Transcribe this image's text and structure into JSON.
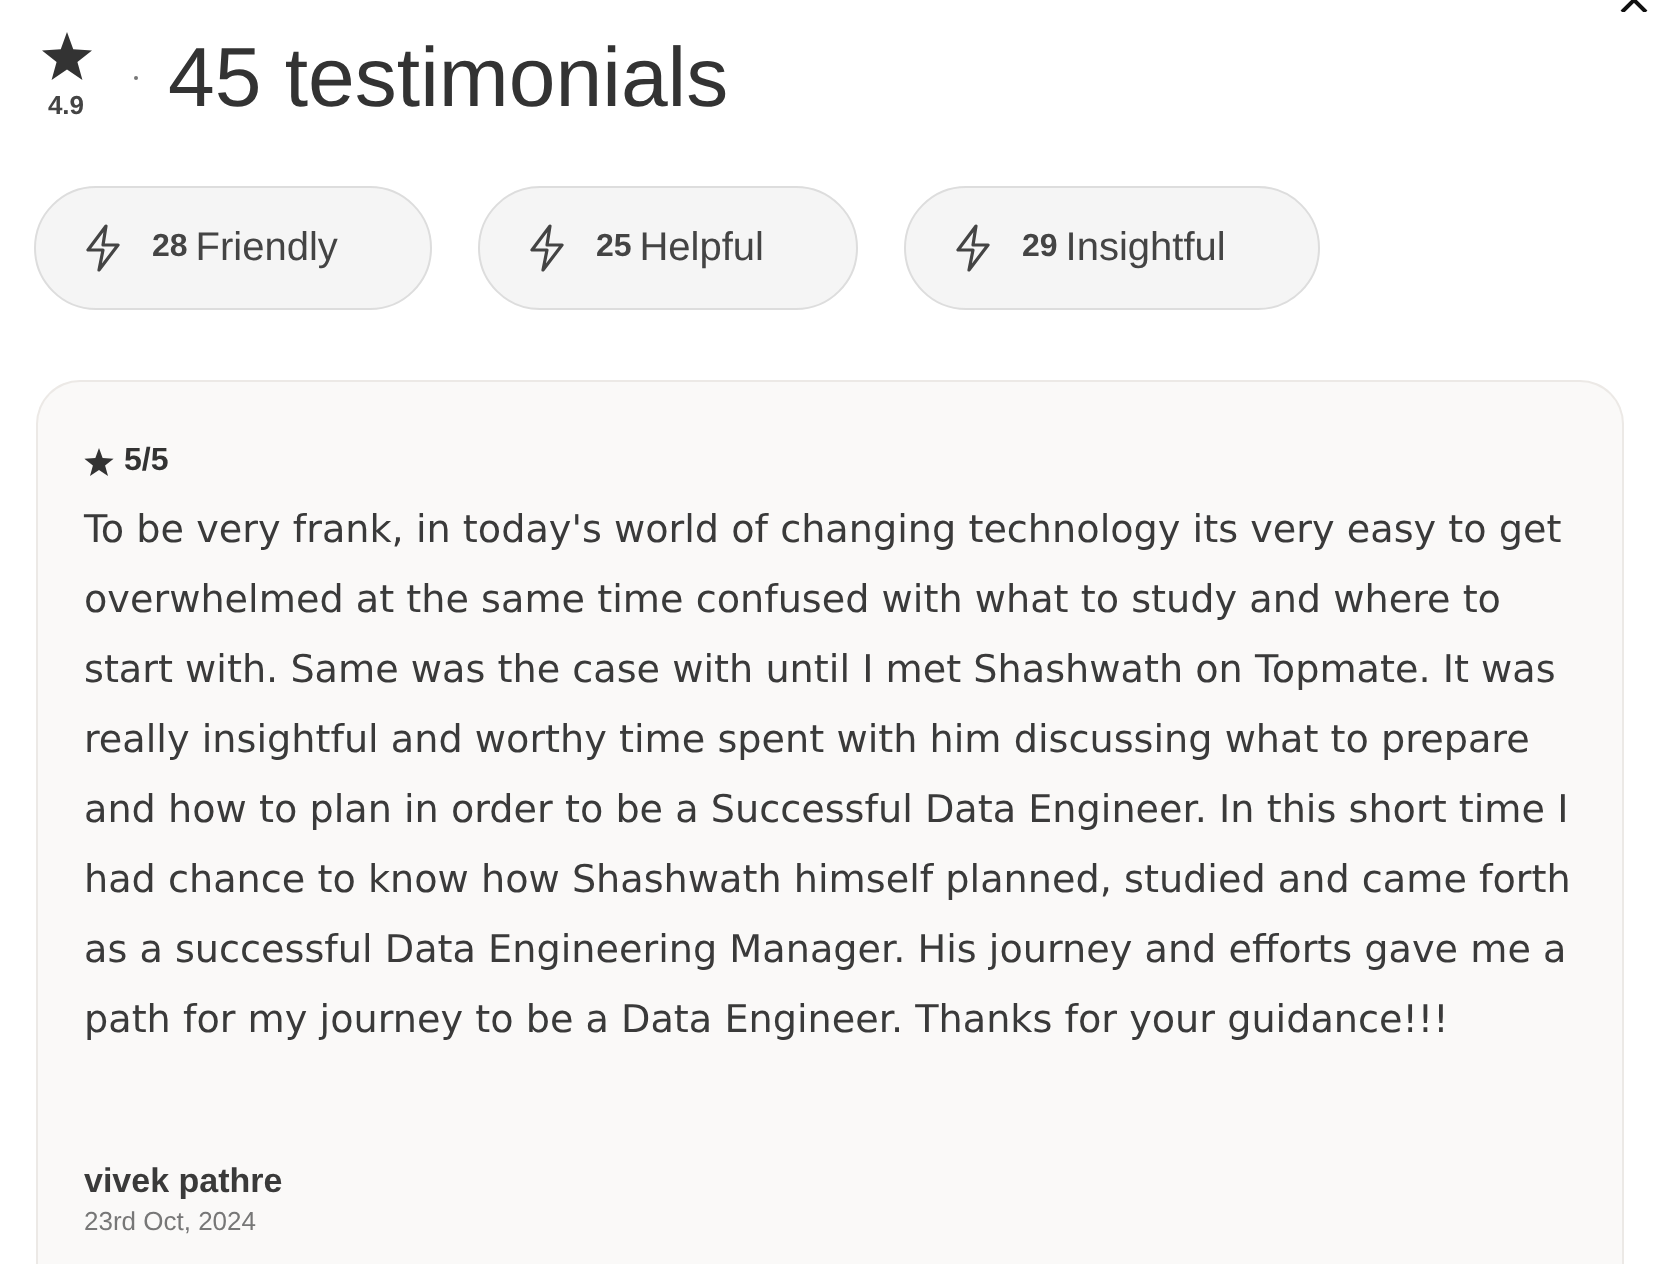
{
  "header": {
    "rating": "4.9",
    "title": "45 testimonials"
  },
  "tags": [
    {
      "count": "28",
      "label": "Friendly"
    },
    {
      "count": "25",
      "label": "Helpful"
    },
    {
      "count": "29",
      "label": "Insightful"
    }
  ],
  "testimonial": {
    "rating": "5/5",
    "text": "To be very frank, in today's world of changing technology its very easy to get overwhelmed at the same time confused with what to study and where to start with. Same was the case with until I met Shashwath on Topmate. It was really insightful and worthy time spent with him discussing what to prepare and how to plan in order to be a Successful Data Engineer. In this short time I had chance to know how Shashwath himself planned, studied and came forth as a successful Data Engineering Manager. His journey and efforts gave me a path for my journey to be a Data Engineer. Thanks for your guidance!!!",
    "author": "vivek pathre",
    "date": "23rd Oct, 2024"
  }
}
